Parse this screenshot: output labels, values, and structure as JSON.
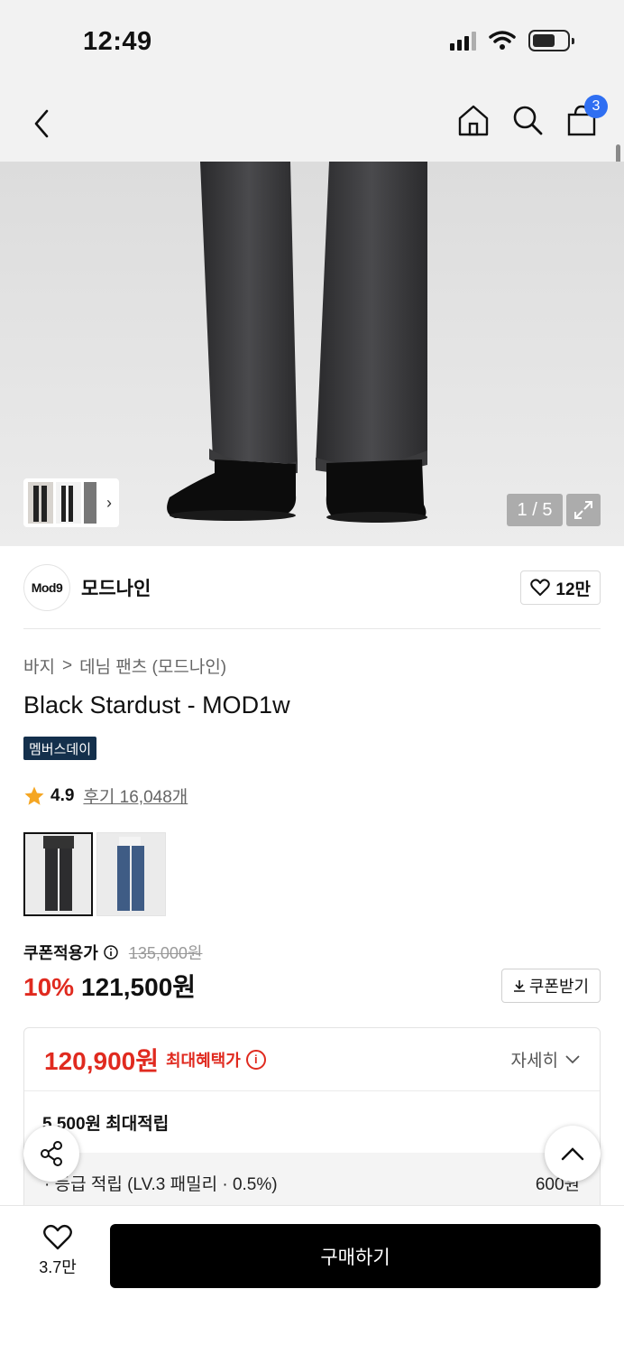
{
  "status_bar": {
    "time": "12:49"
  },
  "nav": {
    "cart_count": "3"
  },
  "hero": {
    "page_indicator": "1 / 5"
  },
  "brand": {
    "logo_text": "Mod9",
    "name": "모드나인",
    "like_count": "12만"
  },
  "breadcrumb": {
    "category": "바지",
    "separator": ">",
    "subcategory": "데님 팬츠 (모드나인)"
  },
  "product": {
    "title": "Black Stardust - MOD1w",
    "badge": "멤버스데이",
    "rating": "4.9",
    "reviews": "후기 16,048개"
  },
  "price": {
    "coupon_label": "쿠폰적용가",
    "original": "135,000원",
    "discount": "10%",
    "sale": "121,500원",
    "coupon_button": "쿠폰받기"
  },
  "benefits": {
    "max_price": "120,900원",
    "max_label": "최대혜택가",
    "info_glyph": "i",
    "detail_label": "자세히",
    "points_total": "5,500원 최대적립",
    "points_item_label": "· 등급 적립 (LV.3 패밀리 · 0.5%)",
    "points_item_value": "600원"
  },
  "bottom": {
    "wish_count": "3.7만",
    "buy_label": "구매하기"
  },
  "colors": {
    "accent_red": "#e02a1f",
    "badge_navy": "#14304c",
    "badge_blue": "#2f6ff2"
  }
}
